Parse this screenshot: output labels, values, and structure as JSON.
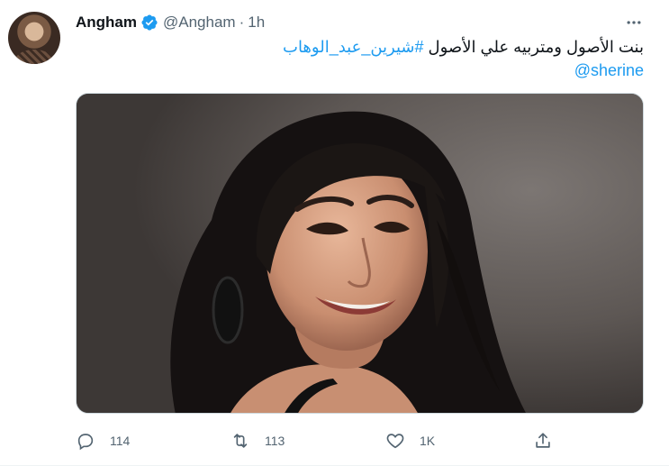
{
  "tweet": {
    "author_name": "Angham",
    "author_handle": "@Angham",
    "separator": "·",
    "time": "1h",
    "text_plain": "بنت الأصول ومتربيه علي الأصول",
    "hashtag": "#شيرين_عبد_الوهاب",
    "mention": "@sherine"
  },
  "actions": {
    "reply_count": "114",
    "retweet_count": "113",
    "like_count": "1K"
  },
  "icons": {
    "verified": "verified-badge-icon",
    "more": "more-options-icon",
    "reply": "reply-icon",
    "retweet": "retweet-icon",
    "like": "heart-icon",
    "share": "share-icon"
  },
  "colors": {
    "accent": "#1d9bf0",
    "text": "#0f1419",
    "muted": "#536471"
  }
}
